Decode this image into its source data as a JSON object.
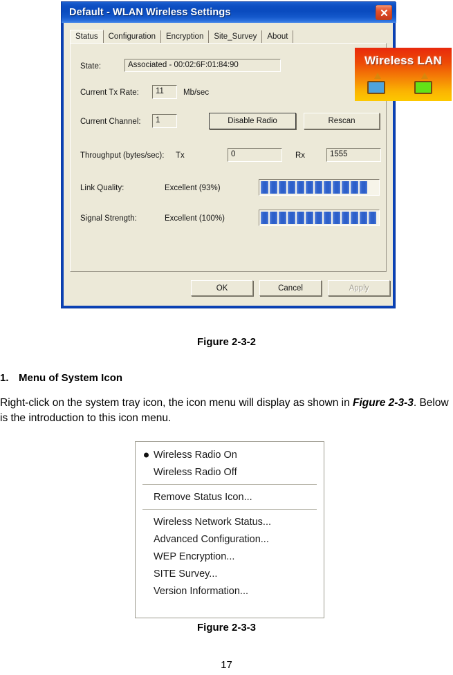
{
  "dialog": {
    "title": "Default - WLAN Wireless Settings",
    "close_icon": "close-icon",
    "tabs": [
      {
        "label": "Status",
        "active": true
      },
      {
        "label": "Configuration",
        "active": false
      },
      {
        "label": "Encryption",
        "active": false
      },
      {
        "label": "Site_Survey",
        "active": false
      },
      {
        "label": "About",
        "active": false
      }
    ],
    "fields": {
      "state_label": "State:",
      "state_value": "Associated - 00:02:6F:01:84:90",
      "tx_rate_label": "Current Tx Rate:",
      "tx_rate_value": "11",
      "tx_rate_unit": "Mb/sec",
      "channel_label": "Current Channel:",
      "channel_value": "1",
      "throughput_label": "Throughput (bytes/sec):",
      "tx_label": "Tx",
      "tx_value": "0",
      "rx_label": "Rx",
      "rx_value": "1555",
      "link_quality_label": "Link Quality:",
      "link_quality_value": "Excellent (93%)",
      "signal_strength_label": "Signal Strength:",
      "signal_strength_value": "Excellent (100%)"
    },
    "meters": {
      "link_quality_segments": 12,
      "signal_strength_segments": 13,
      "segment_color": "#2f62cc"
    },
    "buttons": {
      "disable_radio": "Disable Radio",
      "rescan": "Rescan",
      "ok": "OK",
      "cancel": "Cancel",
      "apply": "Apply"
    },
    "logo": {
      "text": "Wireless LAN",
      "gradient_start": "#e8290c",
      "gradient_end": "#fdc800"
    },
    "titlebar_color": "#0a4bbf",
    "body_color": "#ece9d8"
  },
  "document": {
    "figure_caption_1": "Figure 2-3-2",
    "section_number": "1.",
    "section_heading": "Menu of System Icon",
    "paragraph_part1": "Right-click on the system tray icon, the icon menu will display as shown in ",
    "paragraph_emphasis": "Figure 2-3-3",
    "paragraph_part2": ". Below is the introduction to this icon menu.",
    "figure_caption_2": "Figure 2-3-3",
    "page_number": "17"
  },
  "context_menu": {
    "groups": [
      {
        "items": [
          {
            "label": "Wireless Radio On",
            "selected": true
          },
          {
            "label": "Wireless Radio Off",
            "selected": false
          }
        ]
      },
      {
        "items": [
          {
            "label": "Remove Status Icon...",
            "selected": false
          }
        ]
      },
      {
        "items": [
          {
            "label": "Wireless Network Status...",
            "selected": false
          },
          {
            "label": "Advanced Configuration...",
            "selected": false
          },
          {
            "label": "WEP Encryption...",
            "selected": false
          },
          {
            "label": "SITE Survey...",
            "selected": false
          },
          {
            "label": "Version Information...",
            "selected": false
          }
        ]
      }
    ]
  }
}
